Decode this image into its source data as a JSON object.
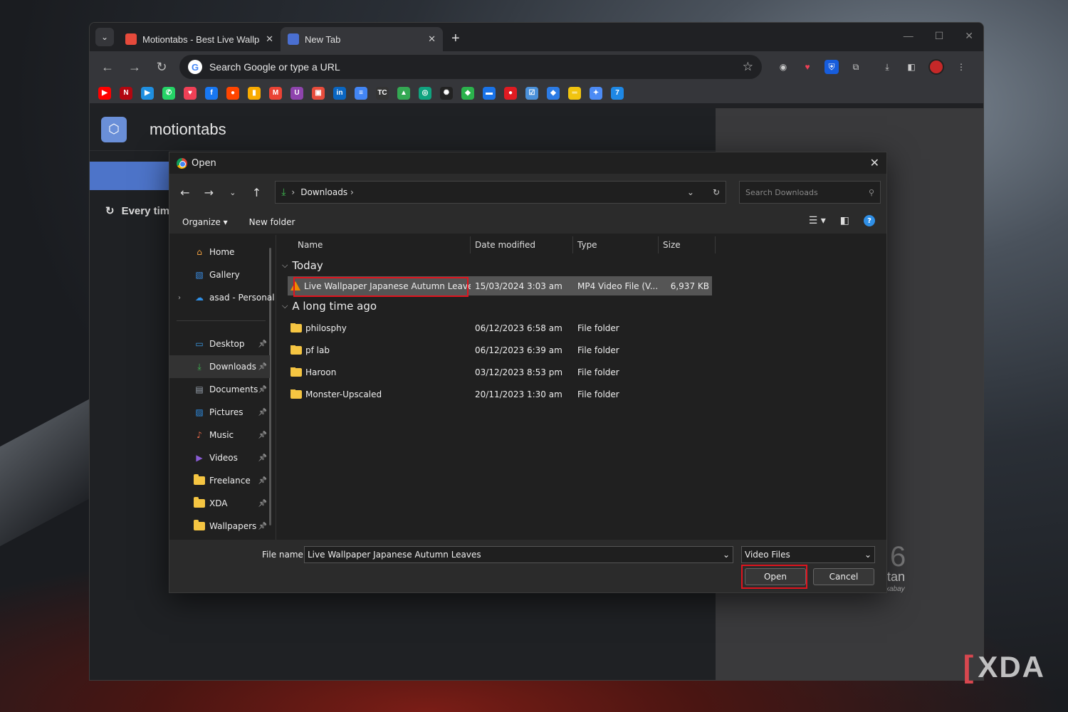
{
  "browser": {
    "tabs": [
      {
        "title": "Motiontabs - Best Live Wallpap",
        "active": false,
        "favicon_color": "#e64a3b"
      },
      {
        "title": "New Tab",
        "active": true,
        "favicon_color": "#4a6fd1"
      }
    ],
    "omnibox_text": "Search Google or type a URL",
    "extensions": [
      "incognito-icon",
      "pocket-icon",
      "bitwarden-icon",
      "extensions-icon",
      "download-icon",
      "sidepanel-icon",
      "profile-avatar",
      "menu-icon"
    ],
    "bookmarks": [
      {
        "name": "youtube",
        "color": "#ff0000",
        "glyph": "▶"
      },
      {
        "name": "netflix",
        "color": "#b20710",
        "glyph": "N"
      },
      {
        "name": "prime",
        "color": "#1f8fe0",
        "glyph": "▶"
      },
      {
        "name": "whatsapp",
        "color": "#25d366",
        "glyph": "✆"
      },
      {
        "name": "pocket",
        "color": "#ef4056",
        "glyph": "♥"
      },
      {
        "name": "facebook",
        "color": "#1877f2",
        "glyph": "f"
      },
      {
        "name": "reddit",
        "color": "#ff4500",
        "glyph": "●"
      },
      {
        "name": "analytics",
        "color": "#f9ab00",
        "glyph": "▮"
      },
      {
        "name": "gmail",
        "color": "#ea4335",
        "glyph": "M"
      },
      {
        "name": "tools",
        "color": "#8e44ad",
        "glyph": "U"
      },
      {
        "name": "shop",
        "color": "#e74c3c",
        "glyph": "▣"
      },
      {
        "name": "linkedin",
        "color": "#0a66c2",
        "glyph": "in"
      },
      {
        "name": "docs",
        "color": "#4285f4",
        "glyph": "≡"
      },
      {
        "name": "tc",
        "color": "#333333",
        "glyph": "TC"
      },
      {
        "name": "drive",
        "color": "#34a853",
        "glyph": "▲"
      },
      {
        "name": "chatgpt",
        "color": "#10a37f",
        "glyph": "◎"
      },
      {
        "name": "openai",
        "color": "#222222",
        "glyph": "✺"
      },
      {
        "name": "feedly",
        "color": "#2bb24c",
        "glyph": "◆"
      },
      {
        "name": "messages",
        "color": "#1a73e8",
        "glyph": "▬"
      },
      {
        "name": "toggl",
        "color": "#e01b22",
        "glyph": "●"
      },
      {
        "name": "tasks",
        "color": "#4a90d9",
        "glyph": "☑"
      },
      {
        "name": "raindrop",
        "color": "#2c7be5",
        "glyph": "◆"
      },
      {
        "name": "dash",
        "color": "#f1c40f",
        "glyph": "═"
      },
      {
        "name": "gemini",
        "color": "#4c8bf5",
        "glyph": "✦"
      },
      {
        "name": "calendar",
        "color": "#1e88e5",
        "glyph": "7"
      }
    ]
  },
  "page": {
    "brand": "motiontabs",
    "every_time": "Every tim",
    "thumb_num": "6",
    "thumb_tan": "tan",
    "thumb_credit": "xabay"
  },
  "dialog": {
    "title": "Open",
    "breadcrumb": "Downloads",
    "search_placeholder": "Search Downloads",
    "organize_label": "Organize",
    "new_folder_label": "New folder",
    "nav": {
      "quick": [
        {
          "label": "Home",
          "icon": "home-icon",
          "color": "#f0a040",
          "glyph": "⌂"
        },
        {
          "label": "Gallery",
          "icon": "gallery-icon",
          "color": "#3a8ee6",
          "glyph": "▧"
        },
        {
          "label": "asad - Personal",
          "icon": "onedrive-icon",
          "color": "#2f8fe6",
          "glyph": "☁"
        }
      ],
      "pinned": [
        {
          "label": "Desktop",
          "icon": "desktop-icon",
          "color": "#3b9de8",
          "glyph": "▭"
        },
        {
          "label": "Downloads",
          "icon": "downloads-icon",
          "color": "#3fb950",
          "glyph": "⤓"
        },
        {
          "label": "Documents",
          "icon": "documents-icon",
          "color": "#9aa4b0",
          "glyph": "▤"
        },
        {
          "label": "Pictures",
          "icon": "pictures-icon",
          "color": "#2f8fe6",
          "glyph": "▨"
        },
        {
          "label": "Music",
          "icon": "music-icon",
          "color": "#e86a4a",
          "glyph": "♪"
        },
        {
          "label": "Videos",
          "icon": "videos-icon",
          "color": "#8a5cd6",
          "glyph": "▶"
        },
        {
          "label": "Freelance",
          "icon": "folder-icon",
          "color": "#f5c542",
          "glyph": ""
        },
        {
          "label": "XDA",
          "icon": "folder-icon",
          "color": "#f5c542",
          "glyph": ""
        },
        {
          "label": "Wallpapers",
          "icon": "folder-icon",
          "color": "#f5c542",
          "glyph": ""
        }
      ]
    },
    "columns": {
      "name": "Name",
      "date": "Date modified",
      "type": "Type",
      "size": "Size"
    },
    "groups": [
      {
        "label": "Today",
        "files": [
          {
            "name": "Live Wallpaper Japanese Autumn Leaves",
            "date": "15/03/2024 3:03 am",
            "type": "MP4 Video File (V...",
            "size": "6,937 KB",
            "kind": "video",
            "selected": true
          }
        ]
      },
      {
        "label": "A long time ago",
        "files": [
          {
            "name": "philosphy",
            "date": "06/12/2023 6:58 am",
            "type": "File folder",
            "size": "",
            "kind": "folder"
          },
          {
            "name": "pf lab",
            "date": "06/12/2023 6:39 am",
            "type": "File folder",
            "size": "",
            "kind": "folder"
          },
          {
            "name": "Haroon",
            "date": "03/12/2023 8:53 pm",
            "type": "File folder",
            "size": "",
            "kind": "folder"
          },
          {
            "name": "Monster-Upscaled",
            "date": "20/11/2023 1:30 am",
            "type": "File folder",
            "size": "",
            "kind": "folder"
          }
        ]
      }
    ],
    "file_name_label": "File name:",
    "file_name_value": "Live Wallpaper Japanese Autumn Leaves",
    "file_type": "Video Files",
    "open_label": "Open",
    "cancel_label": "Cancel"
  },
  "watermark": "XDA"
}
